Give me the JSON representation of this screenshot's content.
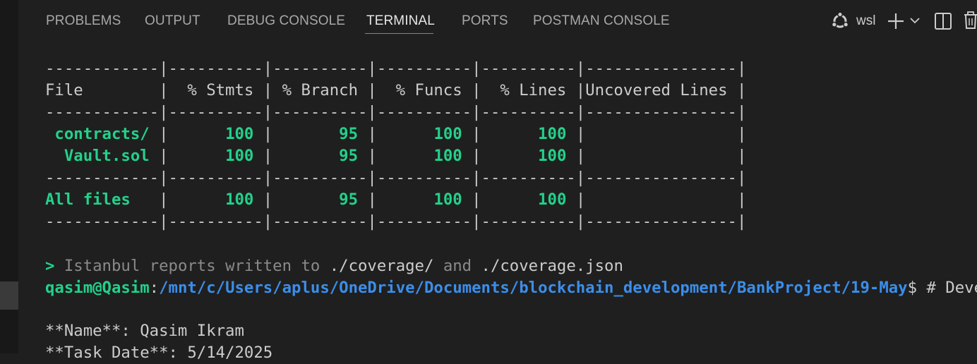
{
  "panel": {
    "tabs": [
      {
        "label": "PROBLEMS"
      },
      {
        "label": "OUTPUT"
      },
      {
        "label": "DEBUG CONSOLE"
      },
      {
        "label": "TERMINAL"
      },
      {
        "label": "PORTS"
      },
      {
        "label": "POSTMAN CONSOLE"
      }
    ],
    "active_tab": "TERMINAL",
    "terminal_profile": "wsl",
    "icons": [
      "ubuntu-icon",
      "plus-icon",
      "chevron-down-icon",
      "split-terminal-icon",
      "trash-icon"
    ]
  },
  "terminal": {
    "table": {
      "sep": "------------|----------|----------|----------|----------|----------------|",
      "header": "File        |  % Stmts | % Branch |  % Funcs |  % Lines |Uncovered Lines |",
      "rows": [
        {
          "file": " contracts/ ",
          "stmts": "      100 ",
          "branch": "       95 ",
          "funcs": "      100 ",
          "lines": "      100 "
        },
        {
          "file": "  Vault.sol ",
          "stmts": "      100 ",
          "branch": "       95 ",
          "funcs": "      100 ",
          "lines": "      100 "
        }
      ],
      "total": {
        "file": "All files   ",
        "stmts": "      100 ",
        "branch": "       95 ",
        "funcs": "      100 ",
        "lines": "      100 "
      },
      "empty_cell": "                |"
    },
    "report_line": {
      "marker": ">",
      "text1": " Istanbul reports written to",
      "path1": " ./coverage/",
      "text2": " and",
      "path2": " ./coverage.json"
    },
    "prompt": {
      "user": "qasim@Qasim",
      "colon": ":",
      "path": "/mnt/c/Users/aplus/OneDrive/Documents/blockchain_development/BankProject/19-May",
      "command": "$ # Develop"
    },
    "name_line": "**Name**: Qasim Ikram",
    "date_line": "**Task Date**: 5/14/2025"
  },
  "colors": {
    "background": "#1f1f1f",
    "accent": "#3794ff",
    "ansi_green": "#23d18b",
    "ansi_blue": "#3b8eea"
  }
}
